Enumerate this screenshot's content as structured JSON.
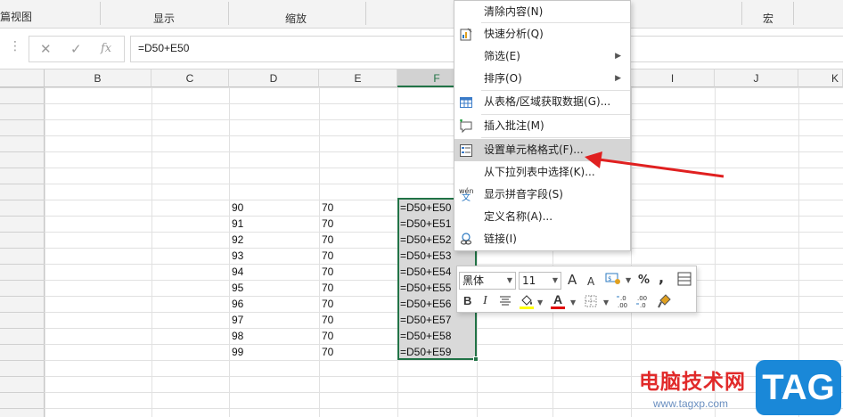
{
  "ribbon": {
    "view_label": "篇视图",
    "show_label": "显示",
    "zoom_label": "缩放",
    "macro_label": "宏"
  },
  "formula_bar": {
    "cancel_icon": "✕",
    "confirm_icon": "✓",
    "fx_label": "fx",
    "formula": "=D50+E50"
  },
  "columns": [
    "B",
    "C",
    "D",
    "E",
    "F",
    "G",
    "H",
    "I",
    "J",
    "K"
  ],
  "rows": [
    {
      "d": "90",
      "e": "70",
      "f": "=D50+E50"
    },
    {
      "d": "91",
      "e": "70",
      "f": "=D50+E51"
    },
    {
      "d": "92",
      "e": "70",
      "f": "=D50+E52"
    },
    {
      "d": "93",
      "e": "70",
      "f": "=D50+E53"
    },
    {
      "d": "94",
      "e": "70",
      "f": "=D50+E54"
    },
    {
      "d": "95",
      "e": "70",
      "f": "=D50+E55"
    },
    {
      "d": "96",
      "e": "70",
      "f": "=D50+E56"
    },
    {
      "d": "97",
      "e": "70",
      "f": "=D50+E57"
    },
    {
      "d": "98",
      "e": "70",
      "f": "=D50+E58"
    },
    {
      "d": "99",
      "e": "70",
      "f": "=D50+E59"
    }
  ],
  "context_menu": {
    "items": [
      {
        "label": "清除内容(N)",
        "icon": "",
        "submenu": false
      },
      {
        "label": "快速分析(Q)",
        "icon": "quick-analysis-icon",
        "submenu": false
      },
      {
        "label": "筛选(E)",
        "icon": "",
        "submenu": true
      },
      {
        "label": "排序(O)",
        "icon": "",
        "submenu": true
      },
      {
        "label": "从表格/区域获取数据(G)...",
        "icon": "table-icon",
        "submenu": false
      },
      {
        "label": "插入批注(M)",
        "icon": "comment-icon",
        "submenu": false
      },
      {
        "label": "设置单元格格式(F)...",
        "icon": "format-cells-icon",
        "submenu": false,
        "highlighted": true
      },
      {
        "label": "从下拉列表中选择(K)...",
        "icon": "",
        "submenu": false
      },
      {
        "label": "显示拼音字段(S)",
        "icon": "phonetic-icon",
        "submenu": false
      },
      {
        "label": "定义名称(A)...",
        "icon": "",
        "submenu": false
      },
      {
        "label": "链接(I)",
        "icon": "link-icon",
        "submenu": false
      }
    ]
  },
  "mini_toolbar": {
    "font_name": "黑体",
    "font_size": "11",
    "grow_font": "A",
    "shrink_font": "A",
    "percent": "%",
    "comma": ",",
    "bold": "B",
    "italic": "I",
    "font_color_letter": "A"
  },
  "watermark": {
    "site_name": "电脑技术网",
    "url": "www.tagxp.com",
    "tag": "TAG"
  },
  "colors": {
    "selection_green": "#217346",
    "arrow_red": "#e02020",
    "highlight_yellow": "#ffff00",
    "font_red": "#e00000"
  }
}
